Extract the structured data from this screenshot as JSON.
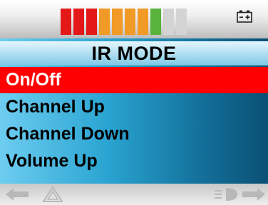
{
  "battery": {
    "segments": [
      {
        "color": "#e41818",
        "active": true
      },
      {
        "color": "#e41818",
        "active": true
      },
      {
        "color": "#e41818",
        "active": true
      },
      {
        "color": "#f29a26",
        "active": true
      },
      {
        "color": "#f29a26",
        "active": true
      },
      {
        "color": "#f29a26",
        "active": true
      },
      {
        "color": "#f29a26",
        "active": true
      },
      {
        "color": "#58b23b",
        "active": true
      },
      {
        "color": "#d4d4d4",
        "active": false
      },
      {
        "color": "#d4d4d4",
        "active": false
      }
    ],
    "icon": "battery-icon"
  },
  "panel": {
    "title": "IR MODE",
    "items": [
      {
        "label": "On/Off",
        "selected": true
      },
      {
        "label": "Channel Up",
        "selected": false
      },
      {
        "label": "Channel Down",
        "selected": false
      },
      {
        "label": "Volume Up",
        "selected": false
      }
    ]
  },
  "nav": {
    "icons": [
      "left-arrow-icon",
      "warning-triangle-icon",
      "headlight-icon",
      "right-arrow-icon"
    ]
  },
  "colors": {
    "selection": "#ff0000",
    "panel_start": "#6dcdf0",
    "panel_end": "#0b4f74"
  }
}
